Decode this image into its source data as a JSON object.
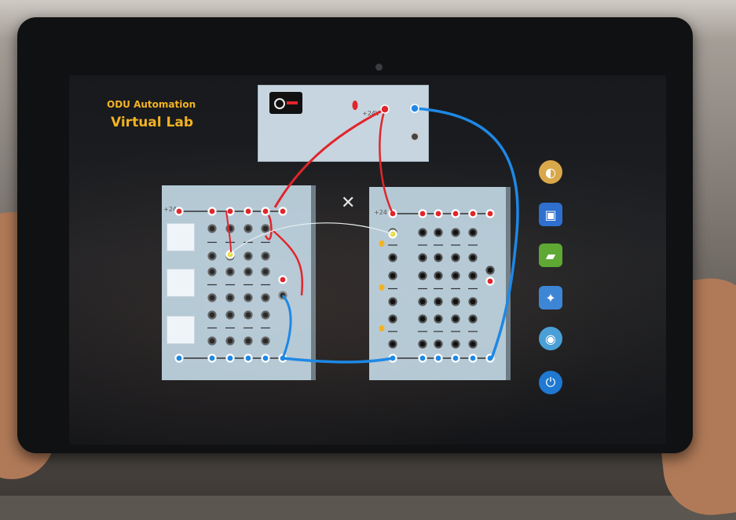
{
  "app": {
    "title_line1": "ODU Automation",
    "title_line2": "Virtual Lab"
  },
  "power_supply": {
    "voltage_label": "+24V"
  },
  "modules": {
    "left": {
      "voltage_label": "+24"
    },
    "right": {
      "voltage_label": "+24"
    }
  },
  "toolbar": {
    "items": [
      {
        "icon": "palette-icon"
      },
      {
        "icon": "save-icon"
      },
      {
        "icon": "open-folder-icon"
      },
      {
        "icon": "wiring-tool-icon"
      },
      {
        "icon": "info-icon"
      },
      {
        "icon": "power-icon"
      }
    ]
  },
  "colors": {
    "title": "#f2b223",
    "wire_red": "#e0262b",
    "wire_blue": "#1e88e5",
    "module": "#cae0ee"
  }
}
